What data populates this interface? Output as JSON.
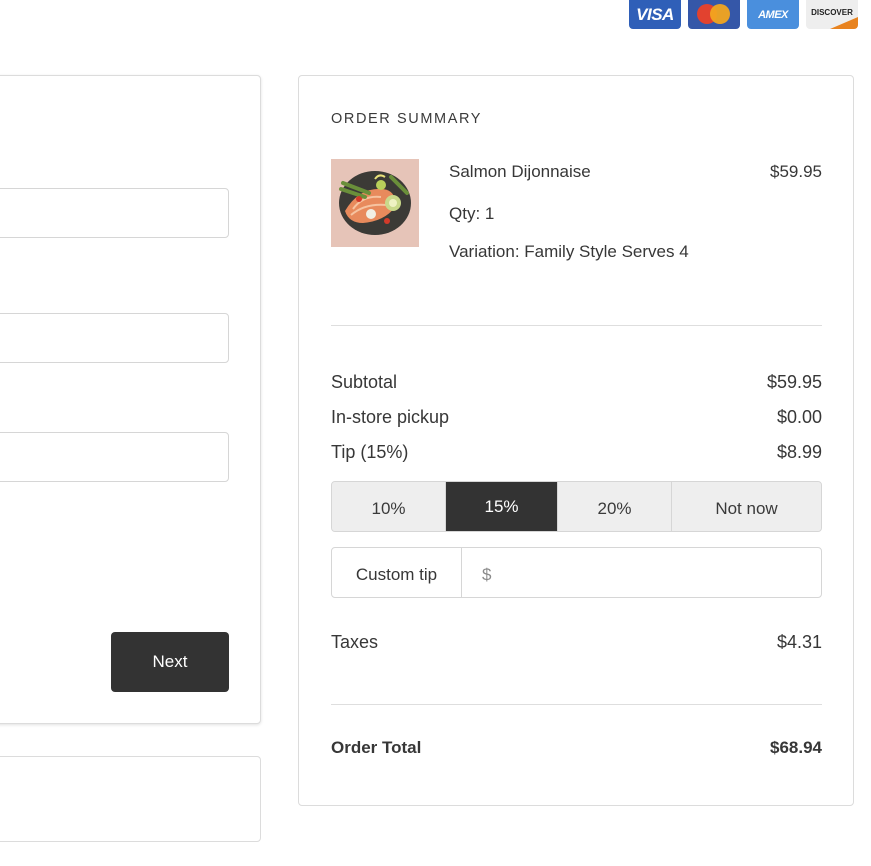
{
  "card_logos": [
    {
      "name": "visa",
      "label": "VISA"
    },
    {
      "name": "mastercard",
      "label": ""
    },
    {
      "name": "amex",
      "label": "AMEX"
    },
    {
      "name": "discover",
      "label": "DISCOVER"
    }
  ],
  "form": {
    "next_label": "Next"
  },
  "summary": {
    "title": "ORDER SUMMARY",
    "item": {
      "name": "Salmon Dijonnaise",
      "price": "$59.95",
      "qty": "Qty: 1",
      "variation": "Variation: Family Style Serves 4"
    },
    "subtotal_label": "Subtotal",
    "subtotal_value": "$59.95",
    "pickup_label": "In-store pickup",
    "pickup_value": "$0.00",
    "tip_label": "Tip (15%)",
    "tip_value": "$8.99",
    "tip_options": [
      "10%",
      "15%",
      "20%",
      "Not now"
    ],
    "tip_selected": "15%",
    "custom_tip_label": "Custom tip",
    "custom_tip_placeholder": "$",
    "taxes_label": "Taxes",
    "taxes_value": "$4.31",
    "total_label": "Order Total",
    "total_value": "$68.94"
  }
}
